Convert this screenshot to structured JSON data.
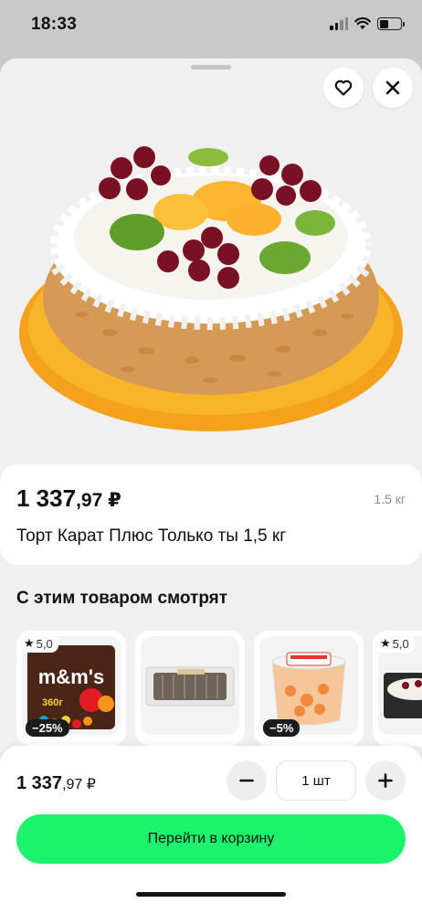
{
  "status_bar": {
    "time": "18:33"
  },
  "product": {
    "price_main": "1 337",
    "price_fraction": ",97 ₽",
    "weight": "1.5 кг",
    "title": "Торт Карат Плюс Только ты 1,5 кг",
    "icons": {
      "favorite": "heart-icon",
      "close": "close-icon"
    }
  },
  "recommendations": {
    "title": "С этим товаром смотрят",
    "items": [
      {
        "rating": "5,0",
        "discount": "−25%",
        "image_label": "m&m's",
        "pack_text": "360г"
      },
      {
        "rating": "",
        "discount": ""
      },
      {
        "rating": "",
        "discount": "−5%"
      },
      {
        "rating": "5,0",
        "discount": ""
      }
    ]
  },
  "bottom_bar": {
    "price_main": "1 337",
    "price_fraction": ",97 ₽",
    "quantity": "1 шт",
    "cart_button": "Перейти в корзину",
    "colors": {
      "cart_button": "#1af36b"
    }
  }
}
